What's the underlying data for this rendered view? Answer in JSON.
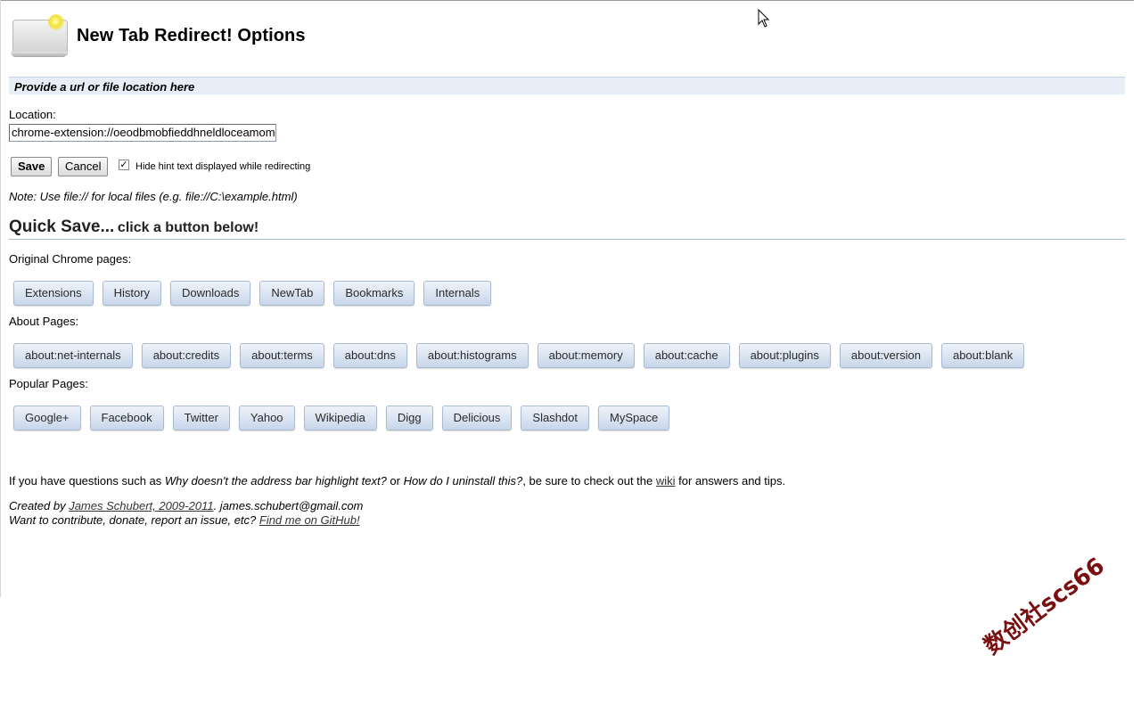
{
  "header": {
    "title": "New Tab Redirect! Options",
    "logo_icon": "laptop-lightbulb-icon"
  },
  "banner": {
    "text": "Provide a url or file location here"
  },
  "location": {
    "label": "Location:",
    "value": "chrome-extension://oeodbmobfieddhneldloceamom"
  },
  "actions": {
    "save_label": "Save",
    "cancel_label": "Cancel",
    "hide_hint_checked": true,
    "hide_hint_label": "Hide hint text displayed while redirecting"
  },
  "note": "Note: Use file:// for local files (e.g. file://C:\\example.html)",
  "quick_save": {
    "heading": "Quick Save...",
    "subheading": "click a button below!"
  },
  "chrome_pages": {
    "label": "Original Chrome pages:",
    "buttons": [
      "Extensions",
      "History",
      "Downloads",
      "NewTab",
      "Bookmarks",
      "Internals"
    ]
  },
  "about_pages": {
    "label": "About Pages:",
    "buttons": [
      "about:net-internals",
      "about:credits",
      "about:terms",
      "about:dns",
      "about:histograms",
      "about:memory",
      "about:cache",
      "about:plugins",
      "about:version",
      "about:blank"
    ]
  },
  "popular_pages": {
    "label": "Popular Pages:",
    "buttons": [
      "Google+",
      "Facebook",
      "Twitter",
      "Yahoo",
      "Wikipedia",
      "Digg",
      "Delicious",
      "Slashdot",
      "MySpace"
    ]
  },
  "faq": {
    "prefix": "If you have questions such as ",
    "q1": "Why doesn't the address bar highlight text?",
    "mid": " or ",
    "q2": "How do I uninstall this?",
    "mid2": ", be sure to check out the ",
    "wiki_link": "wiki",
    "suffix": " for answers and tips."
  },
  "credits": {
    "created_prefix": "Created by ",
    "author_link": "James Schubert, 2009-2011",
    "email": ". james.schubert@gmail.com",
    "contribute_prefix": "Want to contribute, donate, report an issue, etc? ",
    "github_link": "Find me on GitHub!"
  },
  "watermark": "数创社scs66",
  "colors": {
    "banner_bg": "#e8eef8",
    "button_gradient_top": "#eef3fa",
    "button_gradient_bottom": "#c8d6ea",
    "watermark": "#7a0f10"
  }
}
